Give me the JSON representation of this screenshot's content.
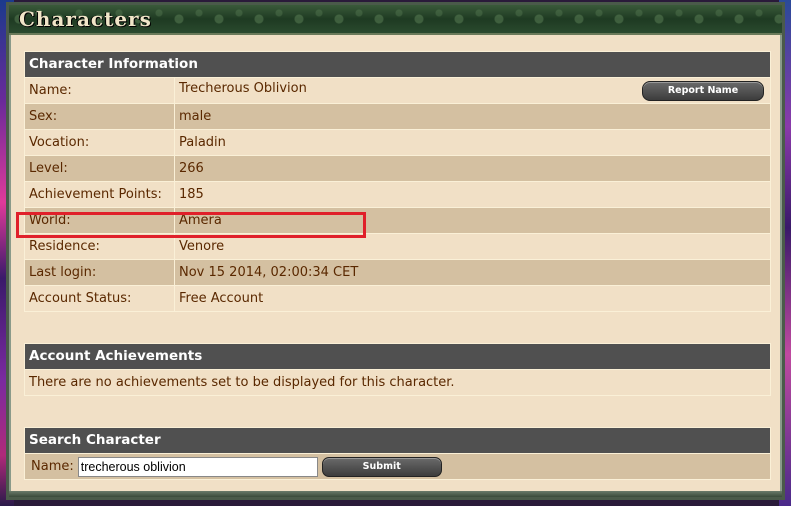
{
  "window": {
    "title": "Characters"
  },
  "character_info": {
    "header": "Character Information",
    "report_button": "Report Name",
    "rows": [
      {
        "label": "Name:",
        "value": "Trecherous Oblivion"
      },
      {
        "label": "Sex:",
        "value": "male"
      },
      {
        "label": "Vocation:",
        "value": "Paladin"
      },
      {
        "label": "Level:",
        "value": "266"
      },
      {
        "label": "Achievement Points:",
        "value": "185"
      },
      {
        "label": "World:",
        "value": "Amera"
      },
      {
        "label": "Residence:",
        "value": "Venore"
      },
      {
        "label": "Last login:",
        "value": "Nov 15 2014, 02:00:34 CET"
      },
      {
        "label": "Account Status:",
        "value": "Free Account"
      }
    ]
  },
  "achievements": {
    "header": "Account Achievements",
    "message": "There are no achievements set to be displayed for this character."
  },
  "search": {
    "header": "Search Character",
    "name_label": "Name:",
    "input_value": "trecherous oblivion",
    "submit_label": "Submit"
  },
  "colors": {
    "highlight": "#e0202a",
    "header_bg": "#505050",
    "row_light": "#f1e0c6",
    "row_dark": "#d4c0a1",
    "text": "#5a2800"
  }
}
